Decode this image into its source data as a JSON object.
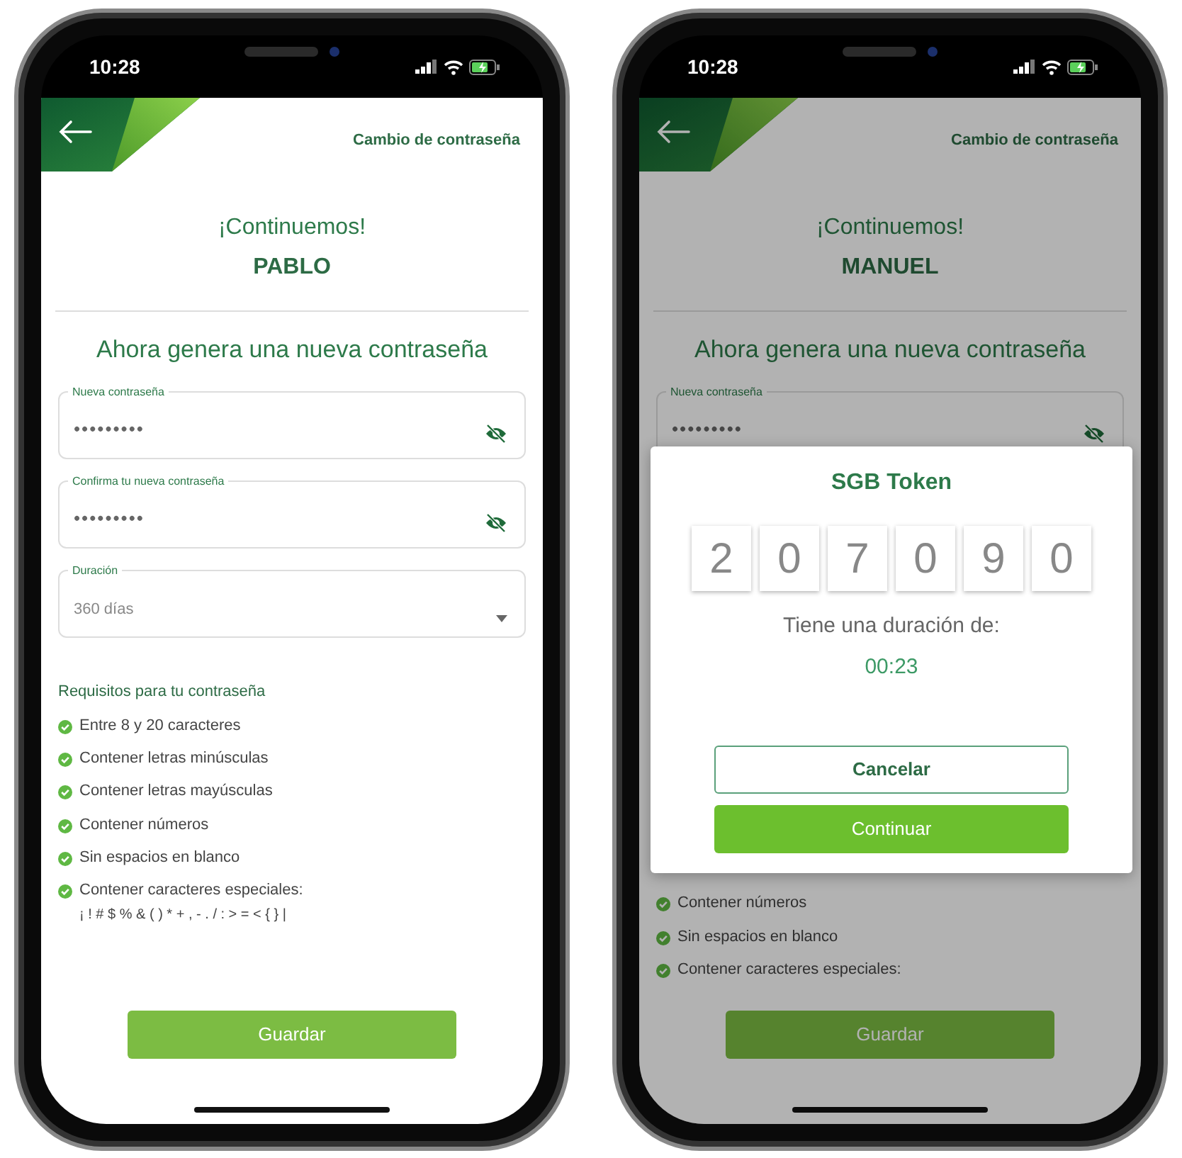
{
  "screens": [
    {
      "status_bar": {
        "time": "10:28"
      },
      "header": {
        "title": "Cambio de contraseña"
      },
      "greeting": "¡Continuemos!",
      "user_name": "PABLO",
      "heading": "Ahora genera una nueva contraseña",
      "fields": [
        {
          "kind": "password",
          "label": "Nueva contraseña",
          "value": "•••••••••"
        },
        {
          "kind": "password",
          "label": "Confirma tu nueva contraseña",
          "value": "•••••••••"
        },
        {
          "kind": "select",
          "label": "Duración",
          "value": "360 días"
        }
      ],
      "requirements": {
        "title": "Requisitos para tu contraseña",
        "items": [
          {
            "text": "Entre 8 y 20 caracteres",
            "met": true
          },
          {
            "text": "Contener letras minúsculas",
            "met": true
          },
          {
            "text": "Contener letras mayúsculas",
            "met": true
          },
          {
            "text": "Contener números",
            "met": true
          },
          {
            "text": "Sin espacios en blanco",
            "met": true
          },
          {
            "text": "Contener caracteres especiales:",
            "detail": "¡ ! # $ % & ( ) * + , - . / : > = < { } |",
            "met": true
          }
        ]
      },
      "save_button": "Guardar"
    },
    {
      "status_bar": {
        "time": "10:28"
      },
      "header": {
        "title": "Cambio de contraseña"
      },
      "greeting": "¡Continuemos!",
      "user_name": "MANUEL",
      "heading": "Ahora genera una nueva contraseña",
      "fields": [
        {
          "kind": "password",
          "label": "Nueva contraseña",
          "value": "•••••••••"
        }
      ],
      "requirements": {
        "items": [
          {
            "text": "Contener números",
            "met": true
          },
          {
            "text": "Sin espacios en blanco",
            "met": true
          },
          {
            "text": "Contener caracteres especiales:",
            "met": true
          }
        ]
      },
      "save_button": "Guardar",
      "dialog": {
        "title": "SGB Token",
        "digits": [
          "2",
          "0",
          "7",
          "0",
          "9",
          "0"
        ],
        "duration_label": "Tiene una duración de:",
        "duration_value": "00:23",
        "buttons": [
          {
            "kind": "secondary",
            "label": "Cancelar"
          },
          {
            "kind": "primary",
            "label": "Continuar"
          }
        ]
      }
    }
  ]
}
